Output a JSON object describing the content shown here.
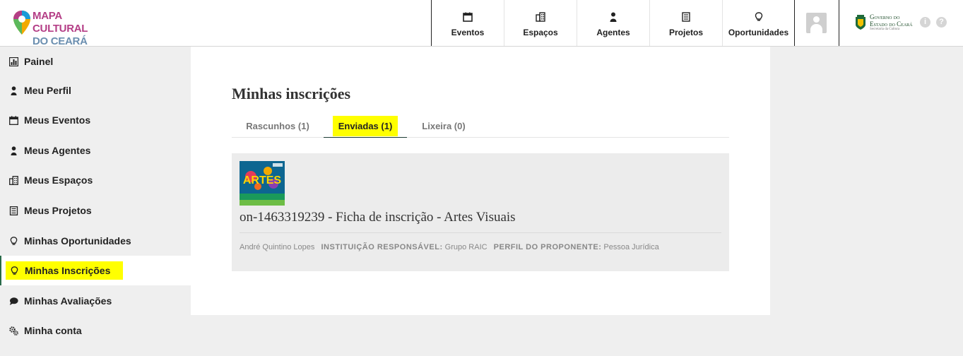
{
  "header": {
    "logo": {
      "line1": "MAPA CULTURAL",
      "line2": "DO CEARÁ"
    },
    "nav": [
      {
        "label": "Eventos",
        "icon": "calendar-icon"
      },
      {
        "label": "Espaços",
        "icon": "building-icon"
      },
      {
        "label": "Agentes",
        "icon": "person-icon"
      },
      {
        "label": "Projetos",
        "icon": "document-icon"
      },
      {
        "label": "Oportunidades",
        "icon": "lightbulb-icon"
      }
    ],
    "gov": {
      "line1": "Governo do",
      "line2": "Estado do Ceará",
      "line3": "Secretaria da Cultura"
    },
    "info_icons": [
      "i",
      "?"
    ]
  },
  "sidebar": {
    "items": [
      {
        "label": "Painel",
        "icon": "chart-icon"
      },
      {
        "label": "Meu Perfil",
        "icon": "person-icon"
      },
      {
        "label": "Meus Eventos",
        "icon": "calendar-icon"
      },
      {
        "label": "Meus Agentes",
        "icon": "person-icon"
      },
      {
        "label": "Meus Espaços",
        "icon": "building-icon"
      },
      {
        "label": "Meus Projetos",
        "icon": "document-icon"
      },
      {
        "label": "Minhas Oportunidades",
        "icon": "lightbulb-icon"
      },
      {
        "label": "Minhas Inscrições",
        "icon": "lightbulb-icon",
        "active": true
      },
      {
        "label": "Minhas Avaliações",
        "icon": "speech-bubble-icon"
      },
      {
        "label": "Minha conta",
        "icon": "gears-icon"
      }
    ]
  },
  "main": {
    "title": "Minhas inscrições",
    "tabs": [
      {
        "label": "Rascunhos (1)"
      },
      {
        "label": "Enviadas (1)",
        "active": true
      },
      {
        "label": "Lixeira (0)"
      }
    ],
    "registration": {
      "thumb_text": "ARTES",
      "title": "on-1463319239 - Ficha de inscrição - Artes Visuais",
      "agent": "André Quintino Lopes",
      "institution_label": "INSTITUIÇÃO RESPONSÁVEL:",
      "institution_value": "Grupo RAIC",
      "profile_label": "PERFIL DO PROPONENTE:",
      "profile_value": "Pessoa Jurídica"
    }
  },
  "colors": {
    "highlight": "#ffff00",
    "brand_purple": "#b43e86",
    "brand_blue": "#6b8fb0",
    "active_border": "#2a6b4a"
  }
}
